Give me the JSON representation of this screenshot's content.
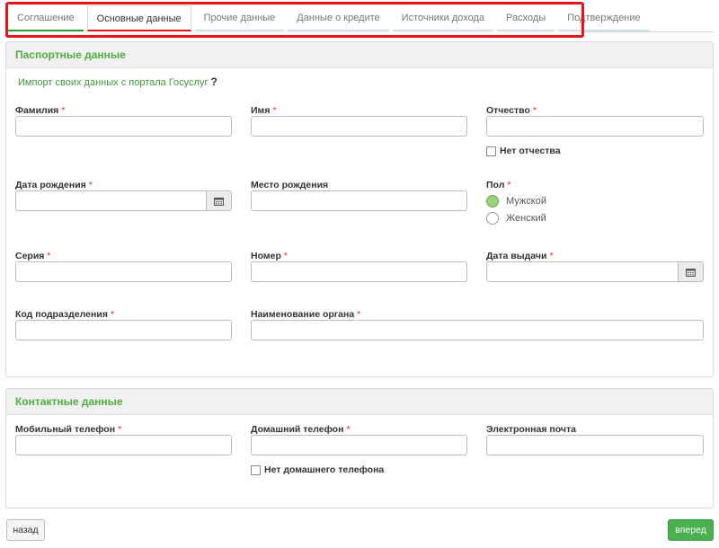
{
  "tabs": [
    {
      "label": "Соглашение",
      "state": "done"
    },
    {
      "label": "Основные данные",
      "state": "active"
    },
    {
      "label": "Прочие данные",
      "state": "pending"
    },
    {
      "label": "Данные о кредите",
      "state": "pending"
    },
    {
      "label": "Источники дохода",
      "state": "pending"
    },
    {
      "label": "Расходы",
      "state": "pending"
    },
    {
      "label": "Подтверждение",
      "state": "pending"
    }
  ],
  "passport": {
    "title": "Паспортные данные",
    "import_link": "Импорт своих данных с портала Госуслуг",
    "help": "?",
    "surname": "Фамилия",
    "name": "Имя",
    "patronymic": "Отчество",
    "no_patronymic": "Нет отчества",
    "birth_date": "Дата рождения",
    "birth_place": "Место рождения",
    "gender": "Пол",
    "gender_options": [
      "Мужской",
      "Женский"
    ],
    "gender_selected": "Мужской",
    "series": "Серия",
    "number": "Номер",
    "issue_date": "Дата выдачи",
    "dept_code": "Код подразделения",
    "authority": "Наименование органа"
  },
  "contacts": {
    "title": "Контактные данные",
    "mobile": "Мобильный телефон",
    "home_phone": "Домашний телефон",
    "email": "Электронная почта",
    "no_home_phone": "Нет домашнего телефона"
  },
  "required_mark": "*",
  "nav": {
    "back": "назад",
    "next": "вперед"
  },
  "colors": {
    "accent_green": "#4caf50",
    "required_red": "#e02a2a",
    "highlight_red": "#e8141b"
  }
}
